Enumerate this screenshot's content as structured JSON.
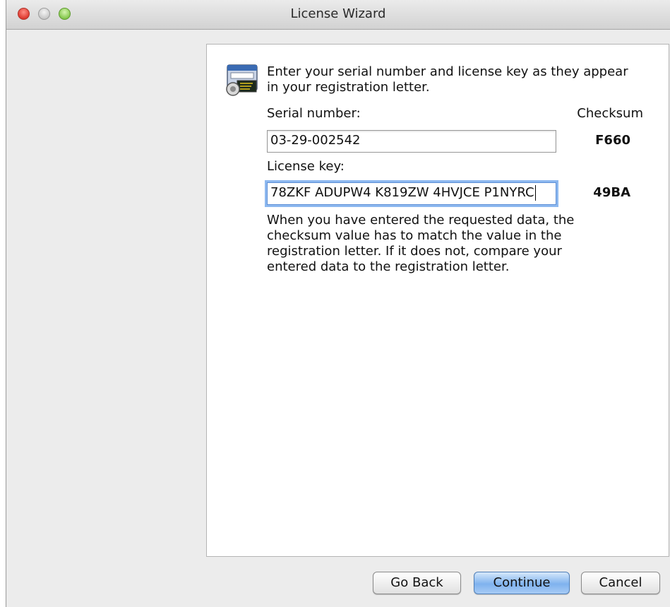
{
  "window": {
    "title": "License Wizard"
  },
  "intro_text": "Enter your serial number and license key as they appear in your registration letter.",
  "serial": {
    "label": "Serial number:",
    "value": "03-29-002542",
    "checksum": "F660"
  },
  "checksum_header": "Checksum",
  "license": {
    "label": "License key:",
    "value": "78ZKF ADUPW4 K819ZW 4HVJCE P1NYRC",
    "checksum": "49BA"
  },
  "explanation": "When you have entered the requested data, the checksum value has to match the value in the registration letter.  If it does not, compare your entered data to the registration letter.",
  "buttons": {
    "back": "Go Back",
    "continue": "Continue",
    "cancel": "Cancel"
  },
  "icons": {
    "app": "license-certificate-icon"
  },
  "colors": {
    "focus_ring": "#8db8ef",
    "primary_button": "#7fb2ee",
    "close": "#de3b30",
    "maximize": "#86c84f"
  }
}
